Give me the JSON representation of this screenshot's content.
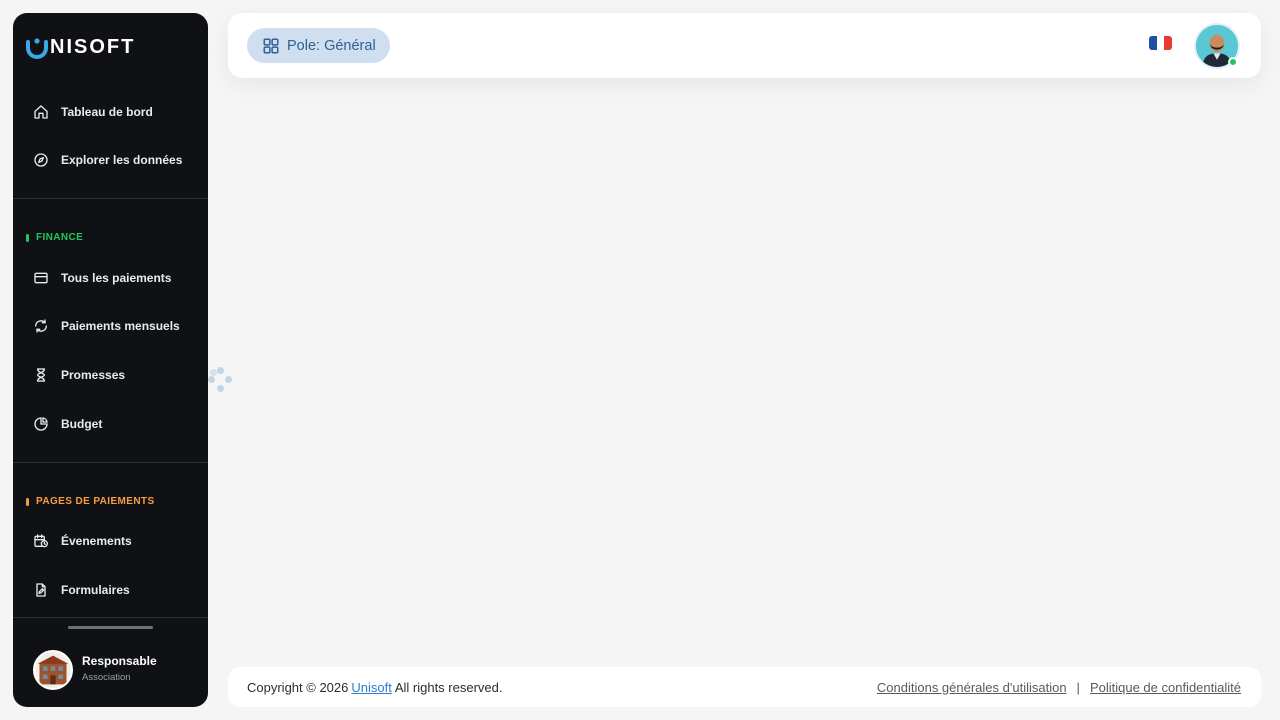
{
  "app": {
    "logo_text": "NISOFT"
  },
  "sidebar": {
    "main_items": [
      {
        "label": "Tableau de bord",
        "icon": "home-icon"
      },
      {
        "label": "Explorer les données",
        "icon": "compass-icon"
      }
    ],
    "finance": {
      "title": "FINANCE",
      "color": "#22c55e",
      "items": [
        {
          "label": "Tous les paiements",
          "icon": "credit-card-icon"
        },
        {
          "label": "Paiements mensuels",
          "icon": "refresh-icon"
        },
        {
          "label": "Promesses",
          "icon": "hourglass-icon"
        },
        {
          "label": "Budget",
          "icon": "pie-chart-icon"
        }
      ]
    },
    "payment_pages": {
      "title": "PAGES DE PAIEMENTS",
      "color": "#f59e42",
      "items": [
        {
          "label": "Évenements",
          "icon": "calendar-clock-icon"
        },
        {
          "label": "Formulaires",
          "icon": "file-edit-icon"
        }
      ]
    },
    "profile": {
      "role": "Responsable",
      "org": "Association"
    }
  },
  "header": {
    "pole_label": "Pole: Général",
    "language_flag": "fr-flag-icon"
  },
  "footer": {
    "copyright_prefix": "Copyright © 2026",
    "brand": "Unisoft",
    "copyright_suffix": "All rights reserved.",
    "terms": "Conditions générales d'utilisation",
    "separator": "|",
    "privacy": "Politique de confidentialité"
  },
  "colors": {
    "sidebar_bg": "#0f1114",
    "accent_blue": "#2b7fd0",
    "pole_bg": "#cfdff0",
    "online": "#22c55e"
  }
}
